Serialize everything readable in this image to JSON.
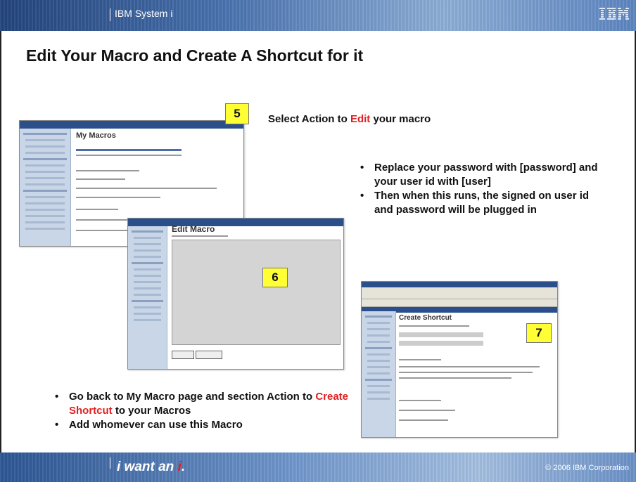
{
  "header": {
    "brand": "IBM System i",
    "logo": "IBM"
  },
  "title": "Edit Your Macro and Create A Shortcut for it",
  "step5": {
    "badge": "5",
    "caption_before": "Select Action to ",
    "caption_highlight": "Edit",
    "caption_after": " your macro",
    "screenshot_heading": "My Macros"
  },
  "step6": {
    "badge": "6",
    "screenshot_heading": "Edit Macro"
  },
  "step7": {
    "badge": "7",
    "screenshot_heading": "Create Shortcut"
  },
  "notes": [
    "Replace your password with [password] and your user id with [user]",
    "Then when this runs, the signed on user id and password will be plugged in"
  ],
  "bottom_bullets": {
    "item1_prefix": "Go back to My Macro page and section Action to ",
    "item1_highlight": "Create Shortcut",
    "item1_suffix": " to your Macros",
    "item2": "Add whomever can use this Macro"
  },
  "footer": {
    "tagline_prefix": "i want an ",
    "tagline_i": "i",
    "tagline_dot": ".",
    "copyright": "© 2006 IBM Corporation"
  },
  "colors": {
    "highlight": "#e02020",
    "badge": "#ffff33",
    "band": "#4a73b0"
  }
}
